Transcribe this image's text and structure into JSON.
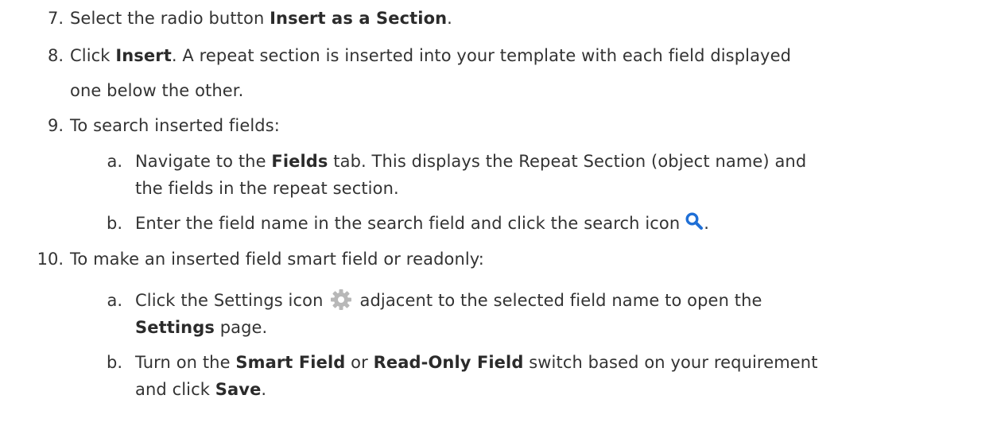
{
  "steps": {
    "s7": {
      "number": "7.",
      "text1": "Select the radio button ",
      "bold1": "Insert as a Section",
      "text2": "."
    },
    "s8": {
      "number": "8.",
      "text1": "Click ",
      "bold1": "Insert",
      "text2": ". A repeat section is inserted into your template with each field displayed",
      "line2": "one below the other."
    },
    "s9": {
      "number": "9.",
      "text1": "To search inserted fields:",
      "a": {
        "marker": "a.",
        "text1": "Navigate to the ",
        "bold1": "Fields",
        "text2": " tab. This displays the Repeat Section (object name) and",
        "line2": "the fields in the repeat section."
      },
      "b": {
        "marker": "b.",
        "text1": "Enter the field name in the search field and click the search icon",
        "text2": "."
      }
    },
    "s10": {
      "number": "10.",
      "text1": "To make an inserted field smart field or readonly:",
      "a": {
        "marker": "a.",
        "text1": "Click the Settings icon",
        "text2": "adjacent to the selected field name to open the",
        "bold1": "Settings",
        "text3": " page."
      },
      "b": {
        "marker": "b.",
        "text1": "Turn on the ",
        "bold1": "Smart Field",
        "text2": " or ",
        "bold2": "Read-Only Field",
        "text3": " switch based on your requirement",
        "line2_text1": "and click ",
        "line2_bold1": "Save",
        "line2_text2": "."
      }
    }
  },
  "icons": {
    "search": "search-icon",
    "settings": "gear-icon"
  },
  "colors": {
    "text": "#333333",
    "search_icon": "#1f6fd6",
    "gear_icon": "#b8b8b8"
  }
}
